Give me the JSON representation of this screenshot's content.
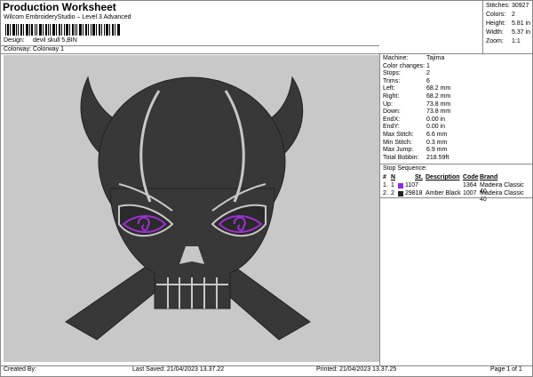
{
  "header": {
    "title": "Production Worksheet",
    "software": "Wilcom EmbroideryStudio – Level 3 Advanced"
  },
  "meta": [
    {
      "label": "Design:",
      "value": "devil skull 5,BIN"
    },
    {
      "label": "Colorway:",
      "value": "Colorway 1"
    }
  ],
  "summary": [
    {
      "label": "Stitches:",
      "value": "30927"
    },
    {
      "label": "Colors:",
      "value": "2"
    },
    {
      "label": "Height:",
      "value": "5.81 in"
    },
    {
      "label": "Width:",
      "value": "5.37 in"
    },
    {
      "label": "Zoom:",
      "value": "1:1"
    }
  ],
  "machine_info": [
    {
      "label": "Machine:",
      "value": "Tajima"
    },
    {
      "label": "Color changes:",
      "value": "1"
    },
    {
      "label": "Stops:",
      "value": "2"
    },
    {
      "label": "Trims:",
      "value": "6"
    },
    {
      "label": "Left:",
      "value": "68.2 mm"
    },
    {
      "label": "Right:",
      "value": "68.2 mm"
    },
    {
      "label": "Up:",
      "value": "73.8 mm"
    },
    {
      "label": "Down:",
      "value": "73.8 mm"
    },
    {
      "label": "EndX:",
      "value": "0.00 in"
    },
    {
      "label": "EndY:",
      "value": "0.00 in"
    },
    {
      "label": "Max Stitch:",
      "value": "6.6 mm"
    },
    {
      "label": "Min Stitch:",
      "value": "0.3 mm"
    },
    {
      "label": "Max Jump:",
      "value": "6.9 mm"
    },
    {
      "label": "Total Bobbin:",
      "value": "218.59ft"
    }
  ],
  "stop_sequence": {
    "title": "Stop Sequence:",
    "headers": [
      "#",
      "N",
      "St.",
      "Description",
      "Code",
      "Brand"
    ],
    "rows": [
      {
        "num": "1.",
        "n": "1",
        "color": "#8a2be2",
        "st": "1107",
        "description": "",
        "code": "1364",
        "brand": "Madeira Classic 40"
      },
      {
        "num": "2.",
        "n": "2",
        "color": "#222222",
        "st": "29818",
        "description": "Amber Black",
        "code": "1007",
        "brand": "Madeira Classic 40"
      }
    ]
  },
  "footer": {
    "created_by": "Created By:",
    "last_saved": "Last Saved: 21/04/2023 13.37.22",
    "printed": "Printed: 21/04/2023 13.37.25",
    "page": "Page 1 of 1"
  },
  "colors": {
    "background": "#c8c8c8",
    "skull": "#3a3a3a",
    "eyes": "#9b30d0"
  }
}
